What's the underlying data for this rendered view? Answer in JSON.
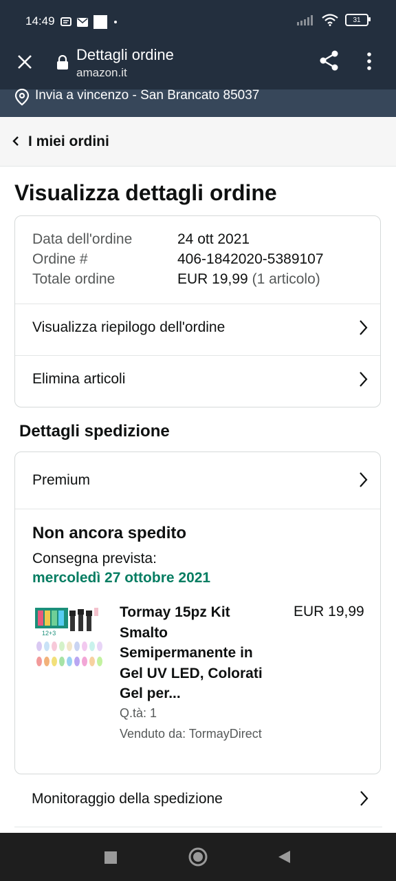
{
  "status_bar": {
    "time": "14:49",
    "battery": "31"
  },
  "app_bar": {
    "title": "Dettagli ordine",
    "url": "amazon.it"
  },
  "location": {
    "text": "Invia a vincenzo - San Brancato 85037"
  },
  "breadcrumb": {
    "label": "I miei ordini"
  },
  "page": {
    "title": "Visualizza dettagli ordine"
  },
  "order_summary": {
    "date_label": "Data dell'ordine",
    "date_value": "24 ott 2021",
    "number_label": "Ordine #",
    "number_value": "406-1842020-5389107",
    "total_label": "Totale ordine",
    "total_value": "EUR 19,99",
    "total_items": "(1 articolo)",
    "view_summary_label": "Visualizza riepilogo dell'ordine",
    "delete_items_label": "Elimina articoli"
  },
  "shipping": {
    "section_title": "Dettagli spedizione",
    "method": "Premium",
    "status": "Non ancora spedito",
    "delivery_label": "Consegna prevista:",
    "delivery_date": "mercoledì 27 ottobre 2021",
    "product": {
      "title": "Tormay 15pz Kit Smalto Semipermanente in Gel UV LED, Colorati Gel per...",
      "price": "EUR 19,99",
      "quantity": "Q.tà: 1",
      "seller": "Venduto da: TormayDirect",
      "image_label": "12+3"
    },
    "tracking_label": "Monitoraggio della spedizione"
  },
  "colors": {
    "header_bg": "#232f3e",
    "location_bg": "#37475a",
    "delivery_green": "#067d62"
  },
  "icons": [
    "close-icon",
    "lock-icon",
    "share-icon",
    "more-menu-icon",
    "location-pin-icon",
    "chevron-left-icon",
    "chevron-right-icon"
  ]
}
